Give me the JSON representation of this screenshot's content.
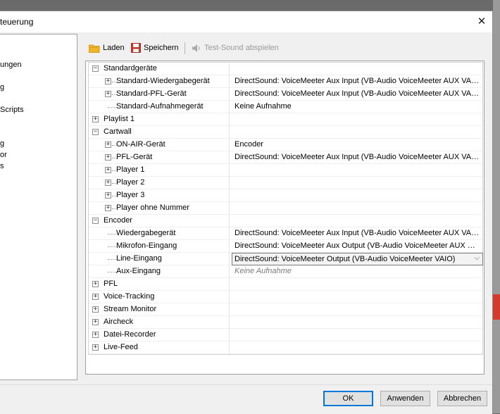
{
  "window": {
    "title": "teuerung",
    "close_glyph": "✕"
  },
  "sidebar": {
    "items": [
      "ungen",
      "g",
      "Scripts",
      "g",
      "or",
      "s"
    ]
  },
  "toolbar": {
    "load_label": "Laden",
    "save_label": "Speichern",
    "test_label": "Test-Sound abspielen"
  },
  "tree": {
    "rows": [
      {
        "label": "Standardgeräte",
        "level": 0,
        "expander": "minus",
        "value": ""
      },
      {
        "label": "Standard-Wiedergabegerät",
        "level": 1,
        "expander": "plus",
        "value": "DirectSound: VoiceMeeter Aux Input (VB-Audio VoiceMeeter AUX VAI..."
      },
      {
        "label": "Standard-PFL-Gerät",
        "level": 1,
        "expander": "plus",
        "value": "DirectSound: VoiceMeeter Aux Input (VB-Audio VoiceMeeter AUX VAI..."
      },
      {
        "label": "Standard-Aufnahmegerät",
        "level": 1,
        "expander": "none",
        "value": "Keine Aufnahme"
      },
      {
        "label": "Playlist 1",
        "level": 0,
        "expander": "plus",
        "value": ""
      },
      {
        "label": "Cartwall",
        "level": 0,
        "expander": "minus",
        "value": ""
      },
      {
        "label": "ON-AIR-Gerät",
        "level": 1,
        "expander": "plus",
        "value": "Encoder"
      },
      {
        "label": "PFL-Gerät",
        "level": 1,
        "expander": "plus",
        "value": "DirectSound: VoiceMeeter Aux Input (VB-Audio VoiceMeeter AUX VAI..."
      },
      {
        "label": "Player 1",
        "level": 1,
        "expander": "plus",
        "value": ""
      },
      {
        "label": "Player 2",
        "level": 1,
        "expander": "plus",
        "value": ""
      },
      {
        "label": "Player 3",
        "level": 1,
        "expander": "plus",
        "value": ""
      },
      {
        "label": "Player ohne Nummer",
        "level": 1,
        "expander": "plus",
        "value": ""
      },
      {
        "label": "Encoder",
        "level": 0,
        "expander": "minus",
        "value": ""
      },
      {
        "label": "Wiedergabegerät",
        "level": 1,
        "expander": "none",
        "value": "DirectSound: VoiceMeeter Aux Input (VB-Audio VoiceMeeter AUX VAI..."
      },
      {
        "label": "Mikrofon-Eingang",
        "level": 1,
        "expander": "none",
        "value": "DirectSound: VoiceMeeter Aux Output (VB-Audio VoiceMeeter AUX VA..."
      },
      {
        "label": "Line-Eingang",
        "level": 1,
        "expander": "none",
        "value": "DirectSound: VoiceMeeter Output (VB-Audio VoiceMeeter VAIO)",
        "combo": true
      },
      {
        "label": "Aux-Eingang",
        "level": 1,
        "expander": "none",
        "value": "Keine Aufnahme",
        "grey": true
      },
      {
        "label": "PFL",
        "level": 0,
        "expander": "plus",
        "value": ""
      },
      {
        "label": "Voice-Tracking",
        "level": 0,
        "expander": "plus",
        "value": ""
      },
      {
        "label": "Stream Monitor",
        "level": 0,
        "expander": "plus",
        "value": ""
      },
      {
        "label": "Aircheck",
        "level": 0,
        "expander": "plus",
        "value": ""
      },
      {
        "label": "Datei-Recorder",
        "level": 0,
        "expander": "plus",
        "value": ""
      },
      {
        "label": "Live-Feed",
        "level": 0,
        "expander": "plus",
        "value": ""
      }
    ]
  },
  "buttons": {
    "ok": "OK",
    "apply": "Anwenden",
    "cancel": "Abbrechen"
  },
  "icons": {
    "load": "folder-icon",
    "save": "floppy-disk-icon",
    "test": "speaker-icon"
  },
  "colors": {
    "accent": "#0078d7",
    "folder": "#f0b429",
    "save_icon": "#c0392b"
  }
}
